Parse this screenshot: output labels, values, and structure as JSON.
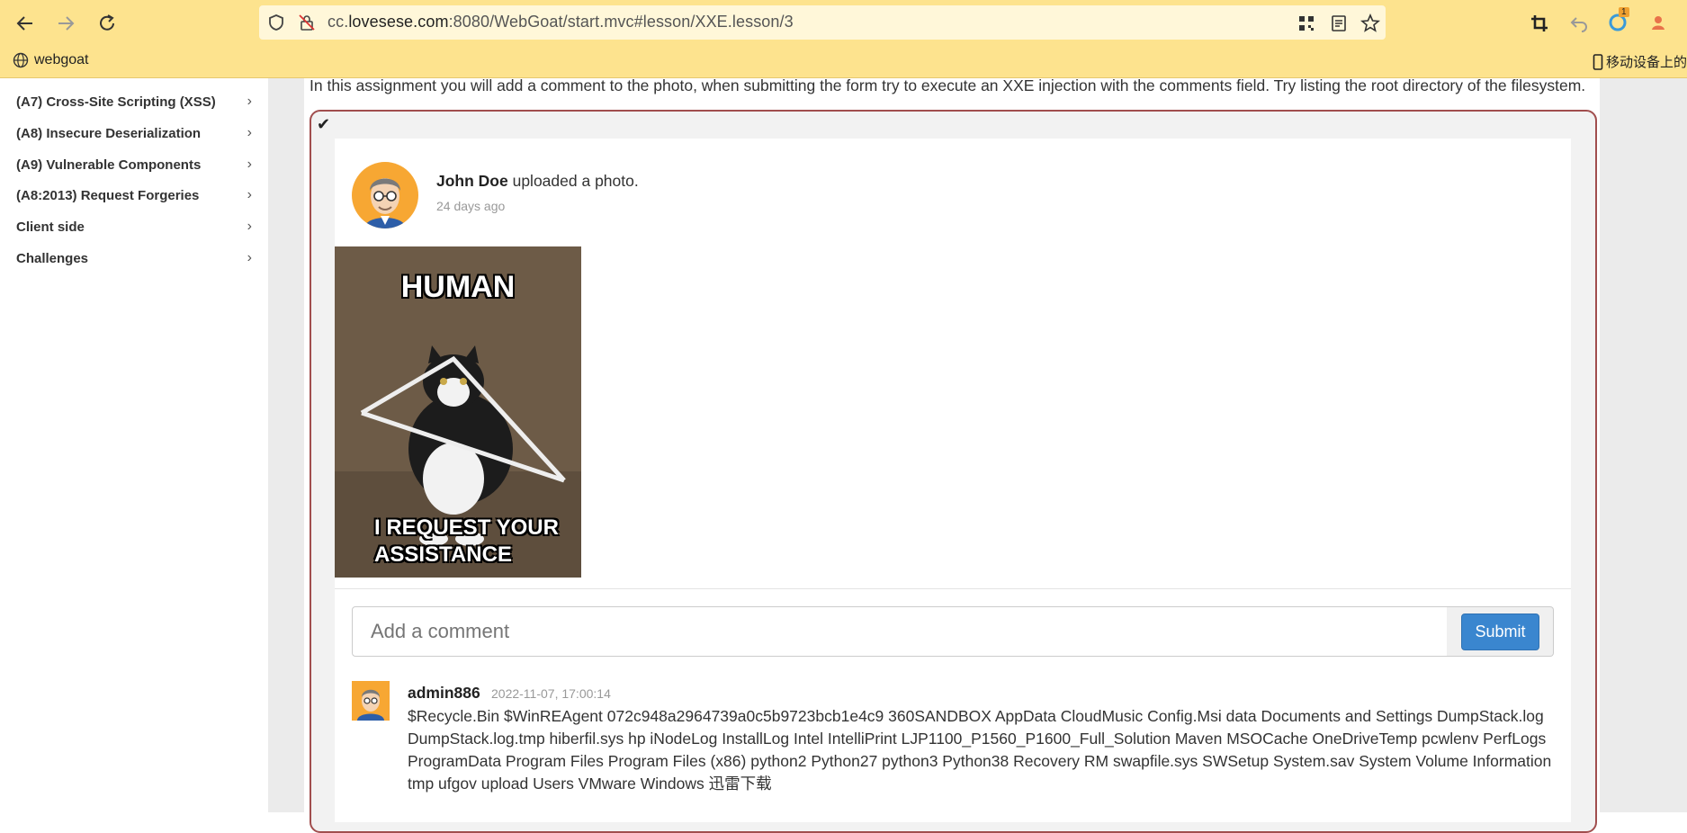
{
  "browser": {
    "url_prefix": "cc.",
    "url_domain": "lovesese.com",
    "url_rest": ":8080/WebGoat/start.mvc#lesson/XXE.lesson/3",
    "bookmark_label": "webgoat",
    "mobile_label": "移动设备上的",
    "notification_count": "1"
  },
  "sidebar": {
    "items": [
      {
        "label": "(A7) Cross-Site Scripting (XSS)",
        "chevron": "›"
      },
      {
        "label": "(A8) Insecure Deserialization",
        "chevron": "›"
      },
      {
        "label": "(A9) Vulnerable Components",
        "chevron": "›"
      },
      {
        "label": "(A8:2013) Request Forgeries",
        "chevron": "›"
      },
      {
        "label": "Client side",
        "chevron": "›"
      },
      {
        "label": "Challenges",
        "chevron": "›"
      }
    ]
  },
  "lesson": {
    "intro": "In this assignment you will add a comment to the photo, when submitting the form try to execute an XXE injection with the comments field. Try listing the root directory of the filesystem.",
    "check_mark": "✔"
  },
  "post": {
    "author": "John Doe",
    "action": " uploaded a photo.",
    "time": "24 days ago",
    "photo_top_text": "HUMAN",
    "photo_bottom_line1": "I REQUEST YOUR",
    "photo_bottom_line2": "ASSISTANCE"
  },
  "comment_form": {
    "placeholder": "Add a comment",
    "submit_label": "Submit"
  },
  "comment": {
    "user": "admin886",
    "time": "2022-11-07, 17:00:14",
    "text": "$Recycle.Bin $WinREAgent 072c948a2964739a0c5b9723bcb1e4c9 360SANDBOX AppData CloudMusic Config.Msi data Documents and Settings DumpStack.log DumpStack.log.tmp hiberfil.sys hp iNodeLog InstallLog Intel IntelliPrint LJP1100_P1560_P1600_Full_Solution Maven MSOCache OneDriveTemp pcwlenv PerfLogs ProgramData Program Files Program Files (x86) python2 Python27 python3 Python38 Recovery RM swapfile.sys SWSetup System.sav System Volume Information tmp ufgov upload Users VMware Windows 迅雷下载"
  },
  "colors": {
    "toolbar": "#fde38e",
    "assignment_border": "#a14e4e",
    "submit_button": "#3a86cf",
    "avatar_bg": "#f7a733"
  }
}
